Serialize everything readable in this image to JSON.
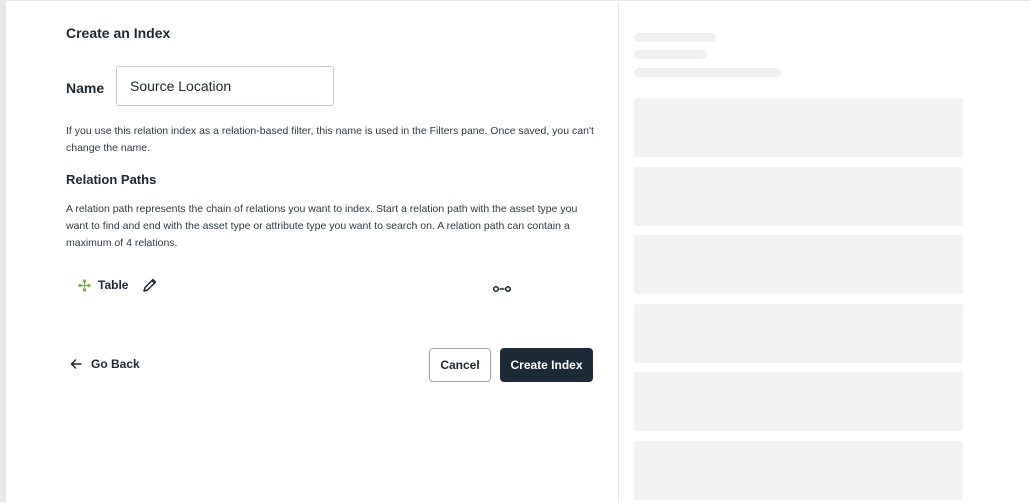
{
  "form": {
    "title": "Create an Index",
    "name_label": "Name",
    "name_value": "Source Location",
    "name_help": "If you use this relation index as a relation-based filter, this name is used in the Filters pane. Once saved, you can't change the name.",
    "relation_paths_title": "Relation Paths",
    "relation_paths_description": "A relation path represents the chain of relations you want to index. Start a relation path with the asset type you want to find and end with the asset type or attribute type you want to search on. A relation path can contain a maximum of 4 relations.",
    "path": {
      "asset_type": "Table",
      "asset_icon": "asset-type-icon",
      "edit_icon": "pencil-icon",
      "relation_icon": "relation-link-icon"
    }
  },
  "actions": {
    "go_back_label": "Go Back",
    "cancel_label": "Cancel",
    "create_label": "Create Index"
  },
  "colors": {
    "primary_button": "#1c2a38",
    "asset_icon": "#7ab648",
    "skeleton": "#eef0f2"
  }
}
